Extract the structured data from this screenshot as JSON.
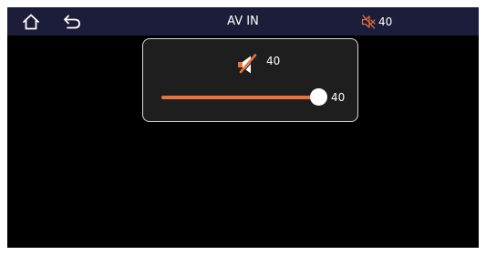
{
  "topbar": {
    "title": "AV IN",
    "volume_text": "40",
    "volume_icon": "speaker-muted-icon",
    "home_icon": "home-icon",
    "back_icon": "back-arrow-icon"
  },
  "volume_popup": {
    "icon": "speaker-muted-icon",
    "value_text": "40",
    "slider_value_text": "40",
    "slider_level": 40,
    "slider_max": 40
  },
  "colors": {
    "accent": "#e8733a",
    "topbar_bg": "#1c1d3a",
    "screen_bg": "#000000",
    "popup_bg": "#1e1e1e"
  }
}
